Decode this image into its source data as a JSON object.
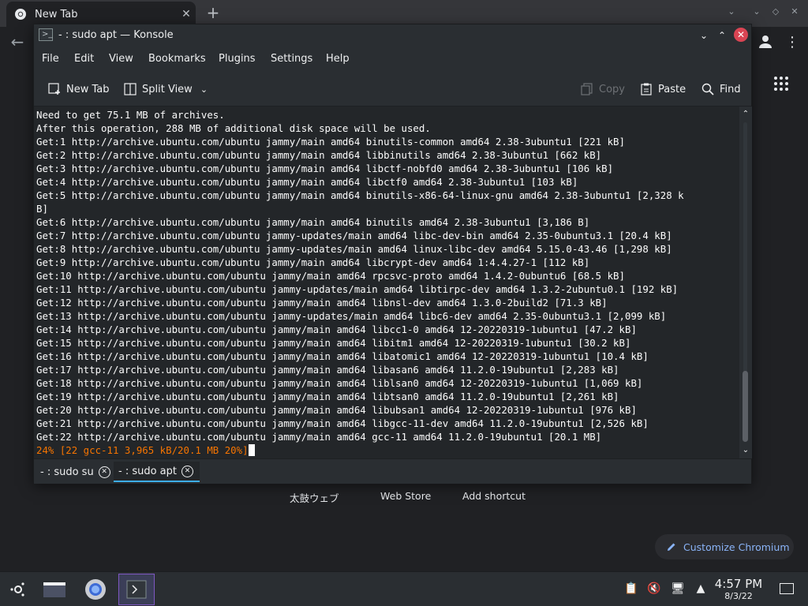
{
  "browser": {
    "tab_title": "New Tab",
    "tab_close": "✕",
    "new_tab": "+",
    "shortcuts": [
      "太鼓ウェブ",
      "Web Store",
      "Add shortcut"
    ],
    "customize_label": "Customize Chromium"
  },
  "konsole": {
    "title": "- : sudo apt — Konsole",
    "menu": [
      "File",
      "Edit",
      "View",
      "Bookmarks",
      "Plugins",
      "Settings",
      "Help"
    ],
    "toolbar": {
      "new_tab": "New Tab",
      "split_view": "Split View",
      "copy": "Copy",
      "paste": "Paste",
      "find": "Find"
    },
    "terminal_lines": [
      "Need to get 75.1 MB of archives.",
      "After this operation, 288 MB of additional disk space will be used.",
      "Get:1 http://archive.ubuntu.com/ubuntu jammy/main amd64 binutils-common amd64 2.38-3ubuntu1 [221 kB]",
      "Get:2 http://archive.ubuntu.com/ubuntu jammy/main amd64 libbinutils amd64 2.38-3ubuntu1 [662 kB]",
      "Get:3 http://archive.ubuntu.com/ubuntu jammy/main amd64 libctf-nobfd0 amd64 2.38-3ubuntu1 [106 kB]",
      "Get:4 http://archive.ubuntu.com/ubuntu jammy/main amd64 libctf0 amd64 2.38-3ubuntu1 [103 kB]",
      "Get:5 http://archive.ubuntu.com/ubuntu jammy/main amd64 binutils-x86-64-linux-gnu amd64 2.38-3ubuntu1 [2,328 k",
      "B]",
      "Get:6 http://archive.ubuntu.com/ubuntu jammy/main amd64 binutils amd64 2.38-3ubuntu1 [3,186 B]",
      "Get:7 http://archive.ubuntu.com/ubuntu jammy-updates/main amd64 libc-dev-bin amd64 2.35-0ubuntu3.1 [20.4 kB]",
      "Get:8 http://archive.ubuntu.com/ubuntu jammy-updates/main amd64 linux-libc-dev amd64 5.15.0-43.46 [1,298 kB]",
      "Get:9 http://archive.ubuntu.com/ubuntu jammy/main amd64 libcrypt-dev amd64 1:4.4.27-1 [112 kB]",
      "Get:10 http://archive.ubuntu.com/ubuntu jammy/main amd64 rpcsvc-proto amd64 1.4.2-0ubuntu6 [68.5 kB]",
      "Get:11 http://archive.ubuntu.com/ubuntu jammy-updates/main amd64 libtirpc-dev amd64 1.3.2-2ubuntu0.1 [192 kB]",
      "Get:12 http://archive.ubuntu.com/ubuntu jammy/main amd64 libnsl-dev amd64 1.3.0-2build2 [71.3 kB]",
      "Get:13 http://archive.ubuntu.com/ubuntu jammy-updates/main amd64 libc6-dev amd64 2.35-0ubuntu3.1 [2,099 kB]",
      "Get:14 http://archive.ubuntu.com/ubuntu jammy/main amd64 libcc1-0 amd64 12-20220319-1ubuntu1 [47.2 kB]",
      "Get:15 http://archive.ubuntu.com/ubuntu jammy/main amd64 libitm1 amd64 12-20220319-1ubuntu1 [30.2 kB]",
      "Get:16 http://archive.ubuntu.com/ubuntu jammy/main amd64 libatomic1 amd64 12-20220319-1ubuntu1 [10.4 kB]",
      "Get:17 http://archive.ubuntu.com/ubuntu jammy/main amd64 libasan6 amd64 11.2.0-19ubuntu1 [2,283 kB]",
      "Get:18 http://archive.ubuntu.com/ubuntu jammy/main amd64 liblsan0 amd64 12-20220319-1ubuntu1 [1,069 kB]",
      "Get:19 http://archive.ubuntu.com/ubuntu jammy/main amd64 libtsan0 amd64 11.2.0-19ubuntu1 [2,261 kB]",
      "Get:20 http://archive.ubuntu.com/ubuntu jammy/main amd64 libubsan1 amd64 12-20220319-1ubuntu1 [976 kB]",
      "Get:21 http://archive.ubuntu.com/ubuntu jammy/main amd64 libgcc-11-dev amd64 11.2.0-19ubuntu1 [2,526 kB]",
      "Get:22 http://archive.ubuntu.com/ubuntu jammy/main amd64 gcc-11 amd64 11.2.0-19ubuntu1 [20.1 MB]"
    ],
    "progress_line": "24% [22 gcc-11 3,965 kB/20.1 MB 20%]",
    "tabs": [
      "- : sudo su",
      "- : sudo apt"
    ],
    "progress_color": "#f67400"
  },
  "taskbar": {
    "time": "4:57 PM",
    "date": "8/3/22"
  }
}
